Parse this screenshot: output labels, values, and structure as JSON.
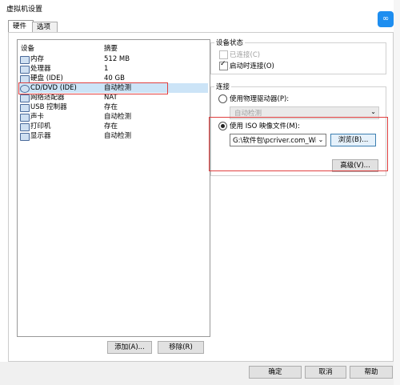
{
  "window": {
    "title": "虚拟机设置"
  },
  "tabs": [
    {
      "label": "硬件"
    },
    {
      "label": "选项"
    }
  ],
  "device_list": {
    "header_device": "设备",
    "header_summary": "摘要",
    "rows": [
      {
        "name": "内存",
        "summary": "512 MB",
        "icon": "memory-icon"
      },
      {
        "name": "处理器",
        "summary": "1",
        "icon": "cpu-icon"
      },
      {
        "name": "硬盘 (IDE)",
        "summary": "40 GB",
        "icon": "harddisk-icon"
      },
      {
        "name": "CD/DVD (IDE)",
        "summary": "自动检测",
        "icon": "cd-dvd-icon"
      },
      {
        "name": "网络适配器",
        "summary": "NAT",
        "icon": "network-icon"
      },
      {
        "name": "USB 控制器",
        "summary": "存在",
        "icon": "usb-icon"
      },
      {
        "name": "声卡",
        "summary": "自动检测",
        "icon": "sound-icon"
      },
      {
        "name": "打印机",
        "summary": "存在",
        "icon": "printer-icon"
      },
      {
        "name": "显示器",
        "summary": "自动检测",
        "icon": "display-icon"
      }
    ]
  },
  "buttons": {
    "add": "添加(A)...",
    "remove": "移除(R)",
    "ok": "确定",
    "cancel": "取消",
    "help": "帮助",
    "browse": "浏览(B)...",
    "advanced": "高级(V)..."
  },
  "device_status": {
    "title": "设备状态",
    "connected": "已连接(C)",
    "connect_on_power": "启动时连接(O)"
  },
  "connection": {
    "title": "连接",
    "use_physical": "使用物理驱动器(P):",
    "physical_value": "自动检测",
    "use_iso": "使用 ISO 映像文件(M):",
    "iso_path": "G:\\软件包\\pcriver.com_Winc"
  },
  "colors": {
    "highlight": "#e04040",
    "selection": "#cce4f7",
    "brand_icon": "#1e8ef0"
  }
}
